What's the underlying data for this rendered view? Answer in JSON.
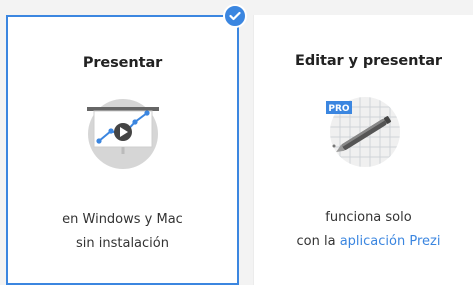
{
  "options": [
    {
      "title": "Presentar",
      "icon": "presentation-screen-play-icon",
      "description_line1": "en Windows y Mac",
      "description_line2": "sin instalación",
      "selected": true
    },
    {
      "title": "Editar y presentar",
      "icon": "pro-pen-icon",
      "badge_text": "PRO",
      "description_line1": "funciona solo",
      "description_line2_prefix": "con la ",
      "description_line2_link": "aplicación Prezi",
      "selected": false
    }
  ],
  "selected_badge_icon": "checkmark-icon",
  "colors": {
    "accent": "#3b86e0",
    "background": "#f3f3f3",
    "card": "#ffffff",
    "text": "#333333",
    "icon_circle": "#d6d6d6",
    "pro_badge": "#3b86e0"
  }
}
